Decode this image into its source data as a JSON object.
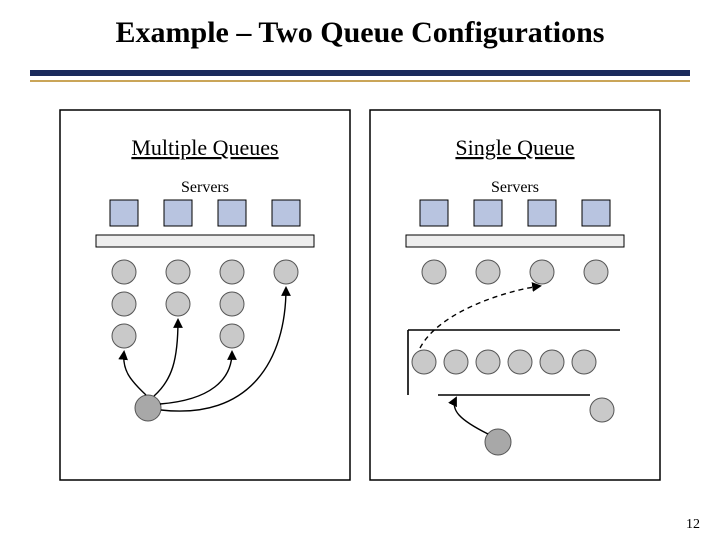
{
  "slide": {
    "title": "Example – Two Queue Configurations",
    "page_number": "12"
  },
  "left": {
    "title": "Multiple Queues",
    "servers_label": "Servers"
  },
  "right": {
    "title": "Single Queue",
    "servers_label": "Servers"
  },
  "colors": {
    "server_fill": "#b8c4e0",
    "person_fill": "#c9c9c9",
    "rule_navy": "#1a2a5c",
    "rule_gold": "#caa558"
  },
  "chart_data": {
    "type": "diagram",
    "title": "Two Queue Configurations",
    "panels": [
      {
        "name": "Multiple Queues",
        "servers": 4,
        "queues": [
          {
            "server_index": 0,
            "waiting": 3
          },
          {
            "server_index": 1,
            "waiting": 2
          },
          {
            "server_index": 2,
            "waiting": 3
          },
          {
            "server_index": 3,
            "waiting": 1
          }
        ],
        "arriving_customer_chooses_queue": true,
        "note": "Arriving customer picks one of the four lines; arrows show possible choices"
      },
      {
        "name": "Single Queue",
        "servers": 4,
        "being_served": 4,
        "single_line_waiting": 6,
        "arriving_customer_joins_tail": true,
        "head_of_line_routes_to_free_server": true,
        "note": "One serpentine line feeds all servers; dashed arrow shows head-of-line going to a server"
      }
    ]
  }
}
